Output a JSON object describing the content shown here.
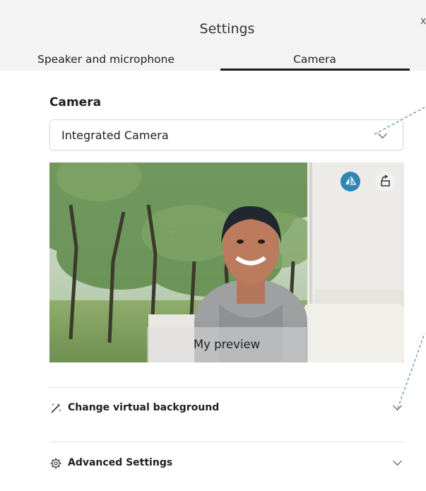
{
  "dialog": {
    "title": "Settings",
    "close_glyph": "x"
  },
  "tabs": [
    {
      "label": "Speaker and microphone",
      "selected": false
    },
    {
      "label": "Camera",
      "selected": true
    }
  ],
  "camera": {
    "section_label": "Camera",
    "selected_device": "Integrated Camera",
    "preview_label": "My preview",
    "mirror_icon": "mirror-icon",
    "rotate_icon": "rotate-icon"
  },
  "expanders": [
    {
      "label": "Change virtual background",
      "icon": "magic-wand-icon"
    },
    {
      "label": "Advanced Settings",
      "icon": "gear-icon"
    }
  ],
  "colors": {
    "accent": "#2f86b6",
    "header_bg": "#f3f3f3"
  }
}
